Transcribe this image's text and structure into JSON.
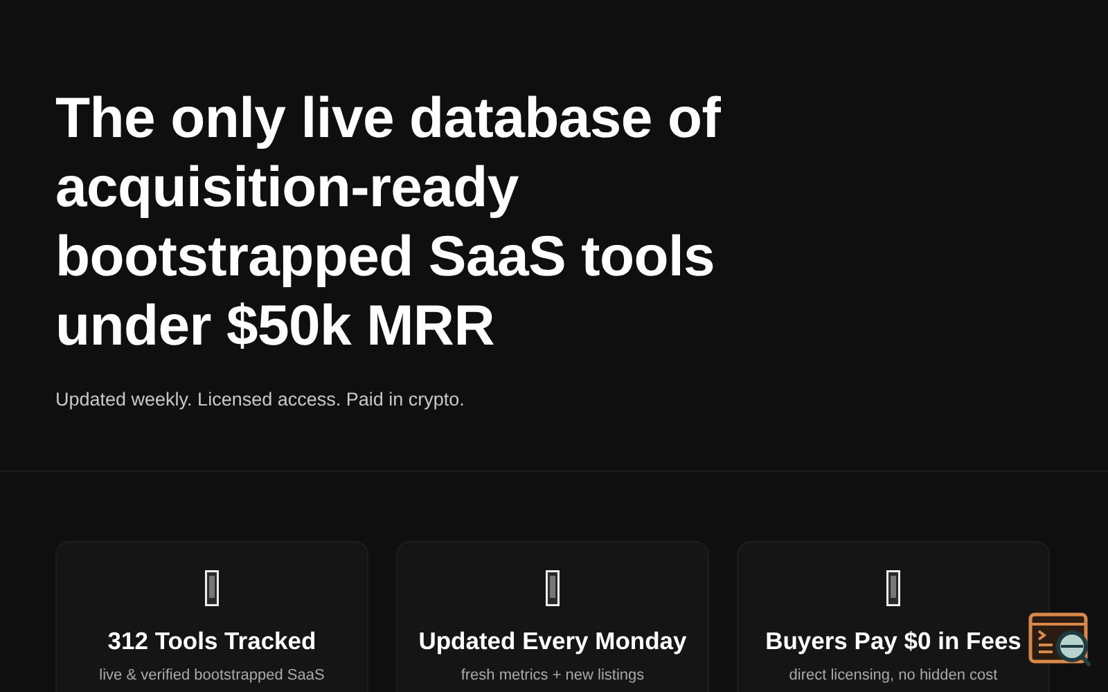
{
  "hero": {
    "title": "The only live database of acquisition-ready bootstrapped SaaS tools under $50k MRR",
    "subtitle": "Updated weekly. Licensed access. Paid in crypto."
  },
  "cards": [
    {
      "title": "312 Tools Tracked",
      "description": "live & verified bootstrapped SaaS"
    },
    {
      "title": "Updated Every Monday",
      "description": "fresh metrics + new listings"
    },
    {
      "title": "Buyers Pay $0 in Fees",
      "description": "direct licensing, no hidden cost"
    }
  ]
}
